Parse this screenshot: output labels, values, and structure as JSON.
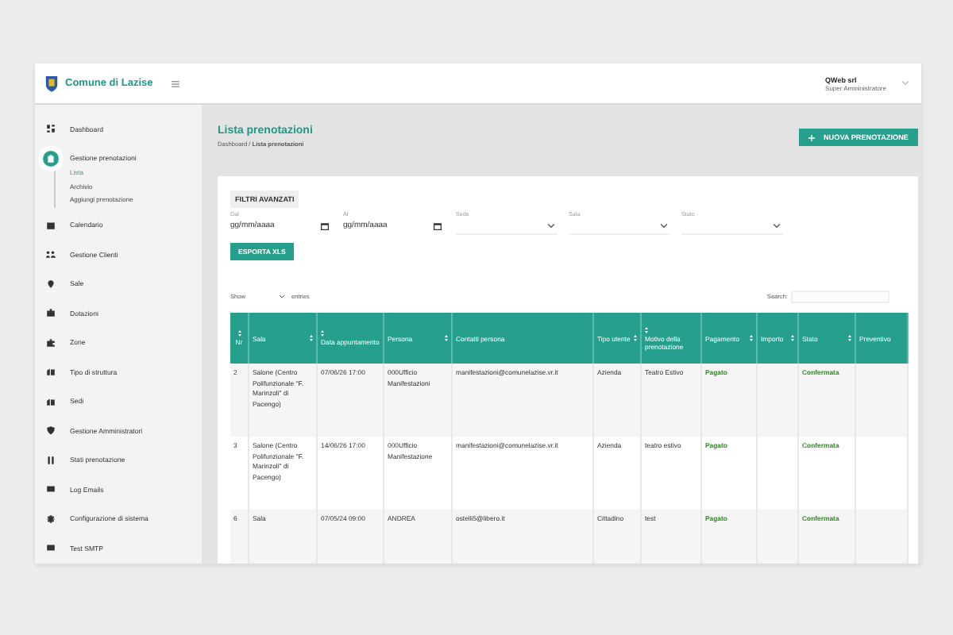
{
  "brand": {
    "name": "Comune di Lazise"
  },
  "user": {
    "name": "QWeb srl",
    "role": "Super Amministratore"
  },
  "sidebar": {
    "items": [
      {
        "label": "Dashboard",
        "expanded": false
      },
      {
        "label": "Gestione prenotazioni",
        "expanded": true,
        "children": [
          {
            "label": "Lista",
            "selected": true
          },
          {
            "label": "Archivio",
            "selected": false
          },
          {
            "label": "Aggiungi prenotazione",
            "selected": false
          }
        ]
      },
      {
        "label": "Calendario",
        "expanded": false
      },
      {
        "label": "Gestione Clienti",
        "expanded": false
      },
      {
        "label": "Sale",
        "expanded": false
      },
      {
        "label": "Dotazioni",
        "expanded": false
      },
      {
        "label": "Zone",
        "expanded": false
      },
      {
        "label": "Tipo di struttura",
        "expanded": false
      },
      {
        "label": "Sedi",
        "expanded": false
      },
      {
        "label": "Gestione Amministratori",
        "expanded": false
      },
      {
        "label": "Stati prenotazione",
        "expanded": false
      },
      {
        "label": "Log Emails",
        "expanded": false
      },
      {
        "label": "Configurazione di sistema",
        "expanded": false
      },
      {
        "label": "Test SMTP",
        "expanded": false
      }
    ]
  },
  "page": {
    "title": "Lista prenotazioni",
    "breadcrumb": "Dashboard / **Lista prenotazioni**",
    "new_button": "NUOVA PRENOTAZIONE"
  },
  "filters": {
    "title": "FILTRI AVANZATI",
    "fields": [
      {
        "label": "Dal",
        "kind": "date",
        "value": "gg/mm/aaaa"
      },
      {
        "label": "Al",
        "kind": "date",
        "value": "gg/mm/aaaa"
      },
      {
        "label": "Sede",
        "kind": "select"
      },
      {
        "label": "Sala",
        "kind": "select"
      },
      {
        "label": "Stato",
        "kind": "select"
      }
    ],
    "export_button": "ESPORTA XLS"
  },
  "table_controls": {
    "show_label": "Show",
    "entries_label": "entries",
    "search_label": "Search:"
  },
  "table": {
    "columns": [
      {
        "label": "Nr",
        "kind": "text",
        "sortable": true
      },
      {
        "label": "Sala",
        "kind": "text",
        "sortable": true
      },
      {
        "label": "Data appuntamento",
        "kind": "text",
        "sortable": true
      },
      {
        "label": "Persona",
        "kind": "text",
        "sortable": true
      },
      {
        "label": "Contatti persona",
        "kind": "text",
        "sortable": false
      },
      {
        "label": "Tipo utente",
        "kind": "text",
        "sortable": true
      },
      {
        "label": "Motivo della prenotazione",
        "kind": "text",
        "sortable": true
      },
      {
        "label": "Pagamento",
        "kind": "status",
        "sortable": true
      },
      {
        "label": "Importo",
        "kind": "text",
        "sortable": true
      },
      {
        "label": "Stato",
        "kind": "status",
        "sortable": true
      },
      {
        "label": "Preventivo",
        "kind": "text",
        "sortable": false
      }
    ],
    "rows": [
      [
        "2",
        "Salone (Centro Polifunzionale \"F. Marinzoli\" di Pacengo)",
        "07/06/26 17:00",
        "000Ufficio Manifestazioni",
        "manifestazioni@comunelazise.vr.it",
        "Azienda",
        "Teatro Estivo",
        "Pagato",
        "",
        "Confermata",
        ""
      ],
      [
        "3",
        "Salone (Centro Polifunzionale \"F. Marinzoli\" di Pacengo)",
        "14/06/26 17:00",
        "000Ufficio Manifestazione",
        "manifestazioni@comunelazise.vr.it",
        "Azienda",
        "teatro estivo",
        "Pagato",
        "",
        "Confermata",
        ""
      ],
      [
        "6",
        "Sala",
        "07/05/24 09:00",
        "ANDREA",
        "ostelli5@libero.it",
        "Cittadino",
        "test",
        "Pagato",
        "",
        "Confermata",
        ""
      ]
    ]
  }
}
